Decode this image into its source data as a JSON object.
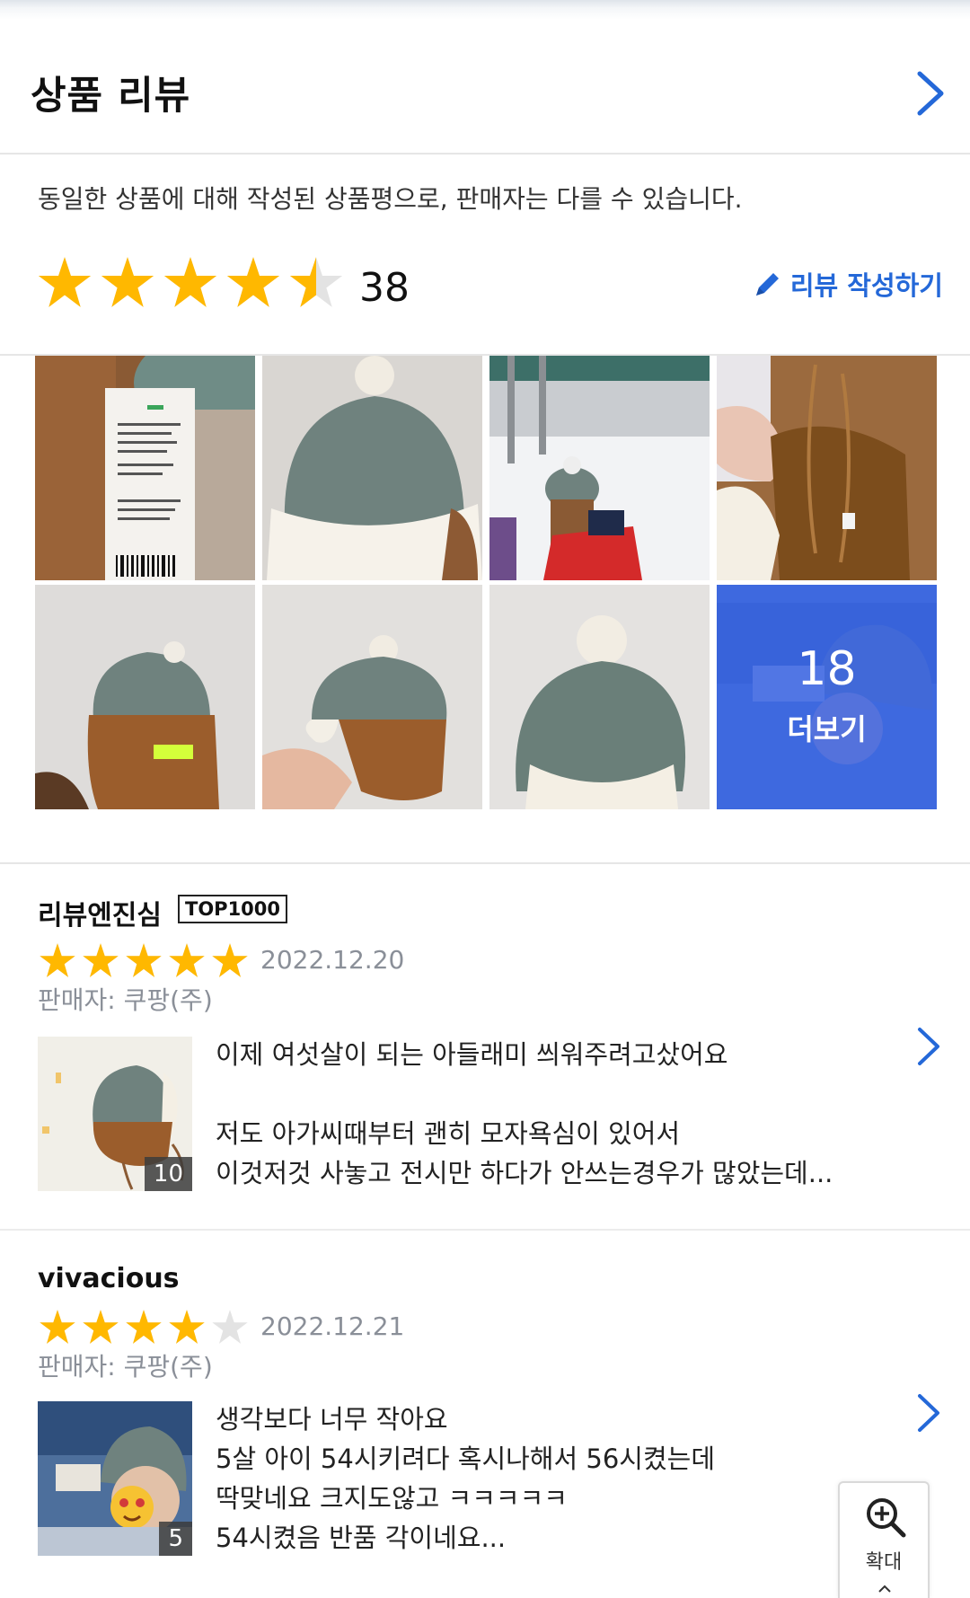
{
  "section": {
    "title": "상품 리뷰",
    "notice": "동일한 상품에 대해 작성된 상품평으로, 판매자는 다를 수 있습니다."
  },
  "rating": {
    "stars": 4.5,
    "count": "38"
  },
  "write_button": {
    "label": "리뷰 작성하기",
    "icon": "pencil-icon"
  },
  "gallery": {
    "more_count": "18",
    "more_label": "더보기"
  },
  "reviews": [
    {
      "reviewer": "리뷰엔진심",
      "badge": "TOP1000",
      "stars": 5,
      "date": "2022.12.20",
      "seller": "판매자: 쿠팡(주)",
      "photo_count": "10",
      "text": "이제 여섯살이 되는 아들래미 씌워주려고샀어요\n\n저도 아가씨때부터 괜히 모자욕심이 있어서\n이것저것 사놓고 전시만 하다가 안쓰는경우가 많았는데..."
    },
    {
      "reviewer": "vivacious",
      "badge": "",
      "stars": 4,
      "date": "2022.12.21",
      "seller": "판매자: 쿠팡(주)",
      "photo_count": "5",
      "text": "생각보다 너무 작아요\n5살 아이 54시키려다 혹시나해서 56시켰는데\n딱맞네요 크지도않고 ㅋㅋㅋㅋㅋ\n54시켰음 반품 각이네요..."
    }
  ],
  "zoom_button": {
    "label": "확대"
  },
  "colors": {
    "star": "#ffb800",
    "star_empty": "#e3e3e3",
    "accent": "#2468d8",
    "more_overlay": "#3764eb"
  }
}
